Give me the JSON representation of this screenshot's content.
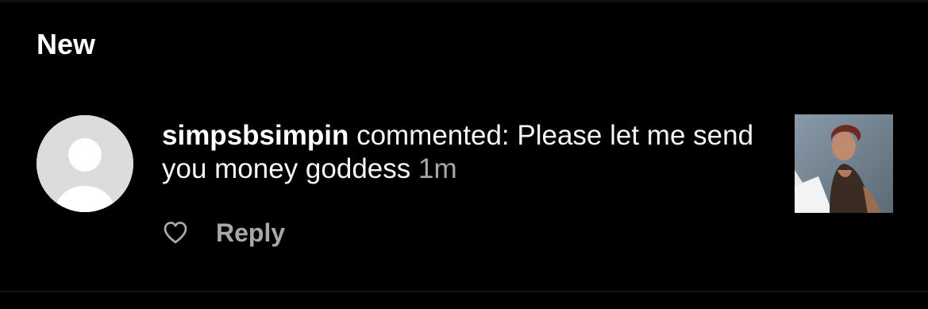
{
  "section": {
    "title": "New"
  },
  "notification": {
    "username": "simpsbsimpin",
    "message": "commented: Please let me send you money goddess",
    "time": "1m",
    "reply_label": "Reply",
    "avatar_icon": "default-profile-icon",
    "like_icon": "heart-outline-icon"
  },
  "colors": {
    "background": "#000000",
    "primary_text": "#ffffff",
    "secondary_text": "#a8a8a8",
    "avatar_bg": "#dcdcdd"
  }
}
